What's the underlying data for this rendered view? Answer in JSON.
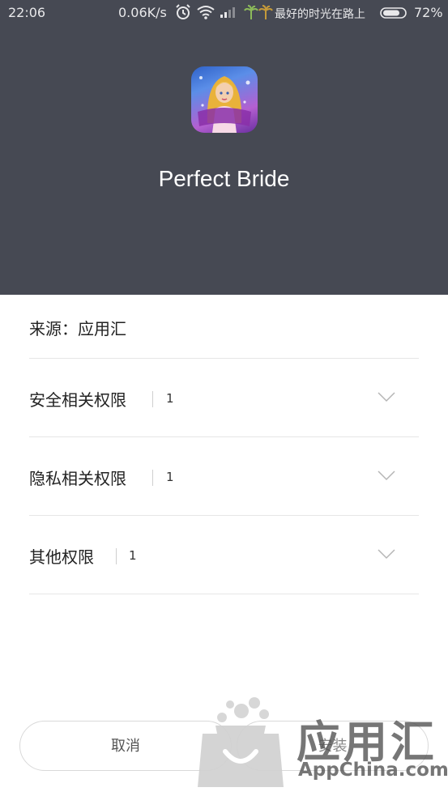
{
  "status_bar": {
    "time": "22:06",
    "net_speed": "0.06K/s",
    "carrier_text": "最好的时光在路上",
    "battery_pct": "72%",
    "icons": [
      "alarm-icon",
      "wifi-icon",
      "signal-icon",
      "palm-tree-icon",
      "battery-icon"
    ]
  },
  "app": {
    "name": "Perfect Bride",
    "icon_text": "Perfect Bride"
  },
  "source": {
    "label": "来源：应用汇"
  },
  "permissions": [
    {
      "label": "安全相关权限",
      "count": "1"
    },
    {
      "label": "隐私相关权限",
      "count": "1"
    },
    {
      "label": "其他权限",
      "count": "1"
    }
  ],
  "buttons": {
    "cancel": "取消",
    "install": "安装"
  },
  "watermark": {
    "title": "应用汇",
    "site": "AppChina.com"
  },
  "colors": {
    "header_bg": "#464953",
    "divider": "#e6e6e6",
    "text": "#222222"
  }
}
